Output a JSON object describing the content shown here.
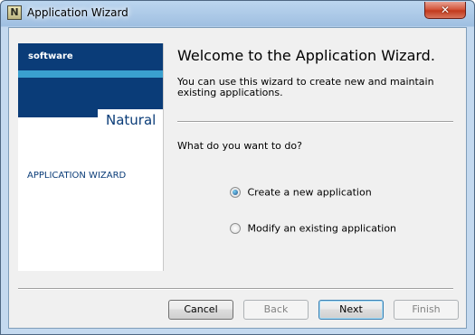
{
  "window": {
    "title": "Application Wizard",
    "app_icon_glyph": "N",
    "close_glyph": "✕"
  },
  "left_panel": {
    "logo_text": "software",
    "product_name": "Natural",
    "caption": "APPLICATION WIZARD"
  },
  "main": {
    "heading": "Welcome to the Application Wizard.",
    "intro": "You can use this wizard to create new and maintain existing applications.",
    "question": "What do you want to do?",
    "options": [
      {
        "label": "Create a new application",
        "selected": true
      },
      {
        "label": "Modify an existing application",
        "selected": false
      }
    ]
  },
  "buttons": {
    "cancel": "Cancel",
    "back": "Back",
    "next": "Next",
    "finish": "Finish"
  },
  "colors": {
    "brand_dark": "#0a3c78",
    "brand_light": "#3aa0cf",
    "close_red": "#c23a1d"
  }
}
